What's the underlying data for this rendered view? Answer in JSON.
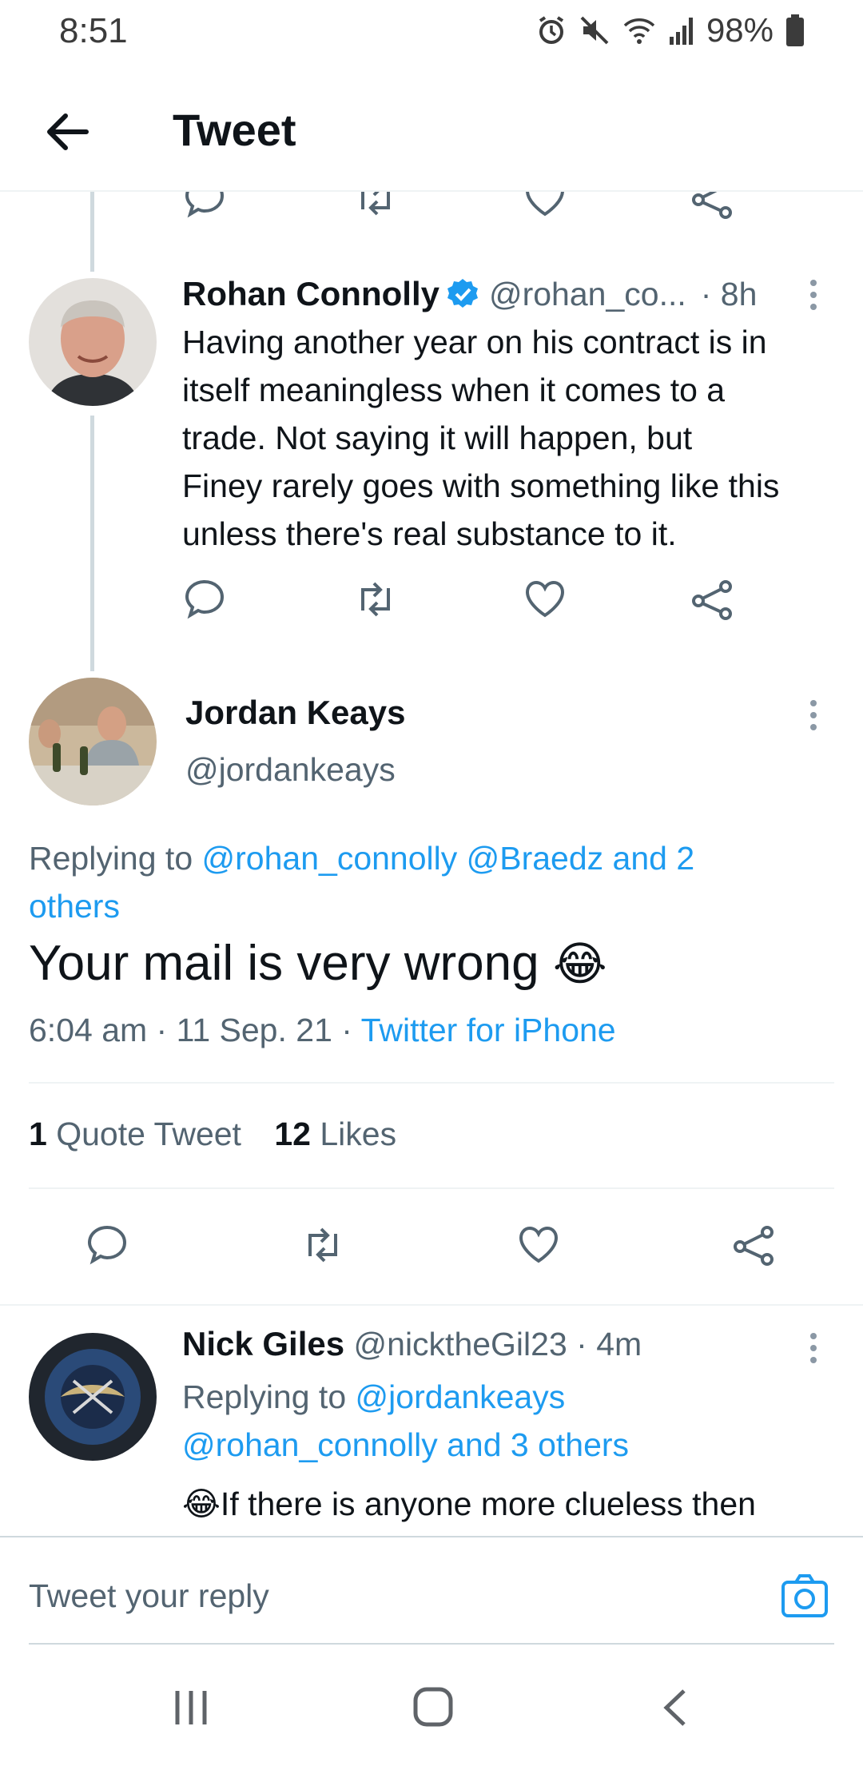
{
  "status_bar": {
    "time": "8:51",
    "battery": "98%",
    "icons": [
      "alarm-icon",
      "mute-icon",
      "wifi-icon",
      "signal-icon",
      "battery-icon"
    ]
  },
  "header": {
    "title": "Tweet",
    "back_icon": "arrow-left-icon"
  },
  "colors": {
    "accent": "#1d9bf0",
    "text": "#0f1419",
    "muted": "#536471",
    "divider": "#eff3f4",
    "icon": "#536471"
  },
  "previous_tweet": {
    "name": "Rohan Connolly",
    "verified": true,
    "handle": "@rohan_co...",
    "time": "· 8h",
    "text_lines": [
      "Having another year on his contract is in",
      "itself meaningless when it comes to a",
      "trade. Not saying it will happen, but",
      "Finey rarely goes with something like this",
      "unless there's real substance to it."
    ]
  },
  "main_tweet": {
    "name": "Jordan Keays",
    "handle": "@jordankeays",
    "replying_prefix": "Replying to",
    "replying_to_line1": "@rohan_connolly @Braedz and 2",
    "replying_to_line2": "others",
    "text": "Your mail is very wrong",
    "emoji": "😂",
    "timestamp": "6:04 am · 11 Sep. 21 ·",
    "source": "Twitter for iPhone",
    "stats": {
      "quote_count": "1",
      "quote_label": "Quote Tweet",
      "like_count": "12",
      "like_label": "Likes"
    }
  },
  "reply_tweet": {
    "name": "Nick Giles",
    "handle": "@nicktheGil23",
    "time": "· 4m",
    "replying_prefix": "Replying to",
    "replying_to_line1": "@jordankeays",
    "replying_to_line2": "@rohan_connolly and 3 others",
    "emoji": "😂",
    "text": "If there is anyone more clueless then"
  },
  "reply_bar": {
    "placeholder": "Tweet your reply",
    "camera_icon": "camera-icon"
  },
  "nav": {
    "icons": [
      "recent-apps-icon",
      "home-icon",
      "back-icon"
    ]
  }
}
